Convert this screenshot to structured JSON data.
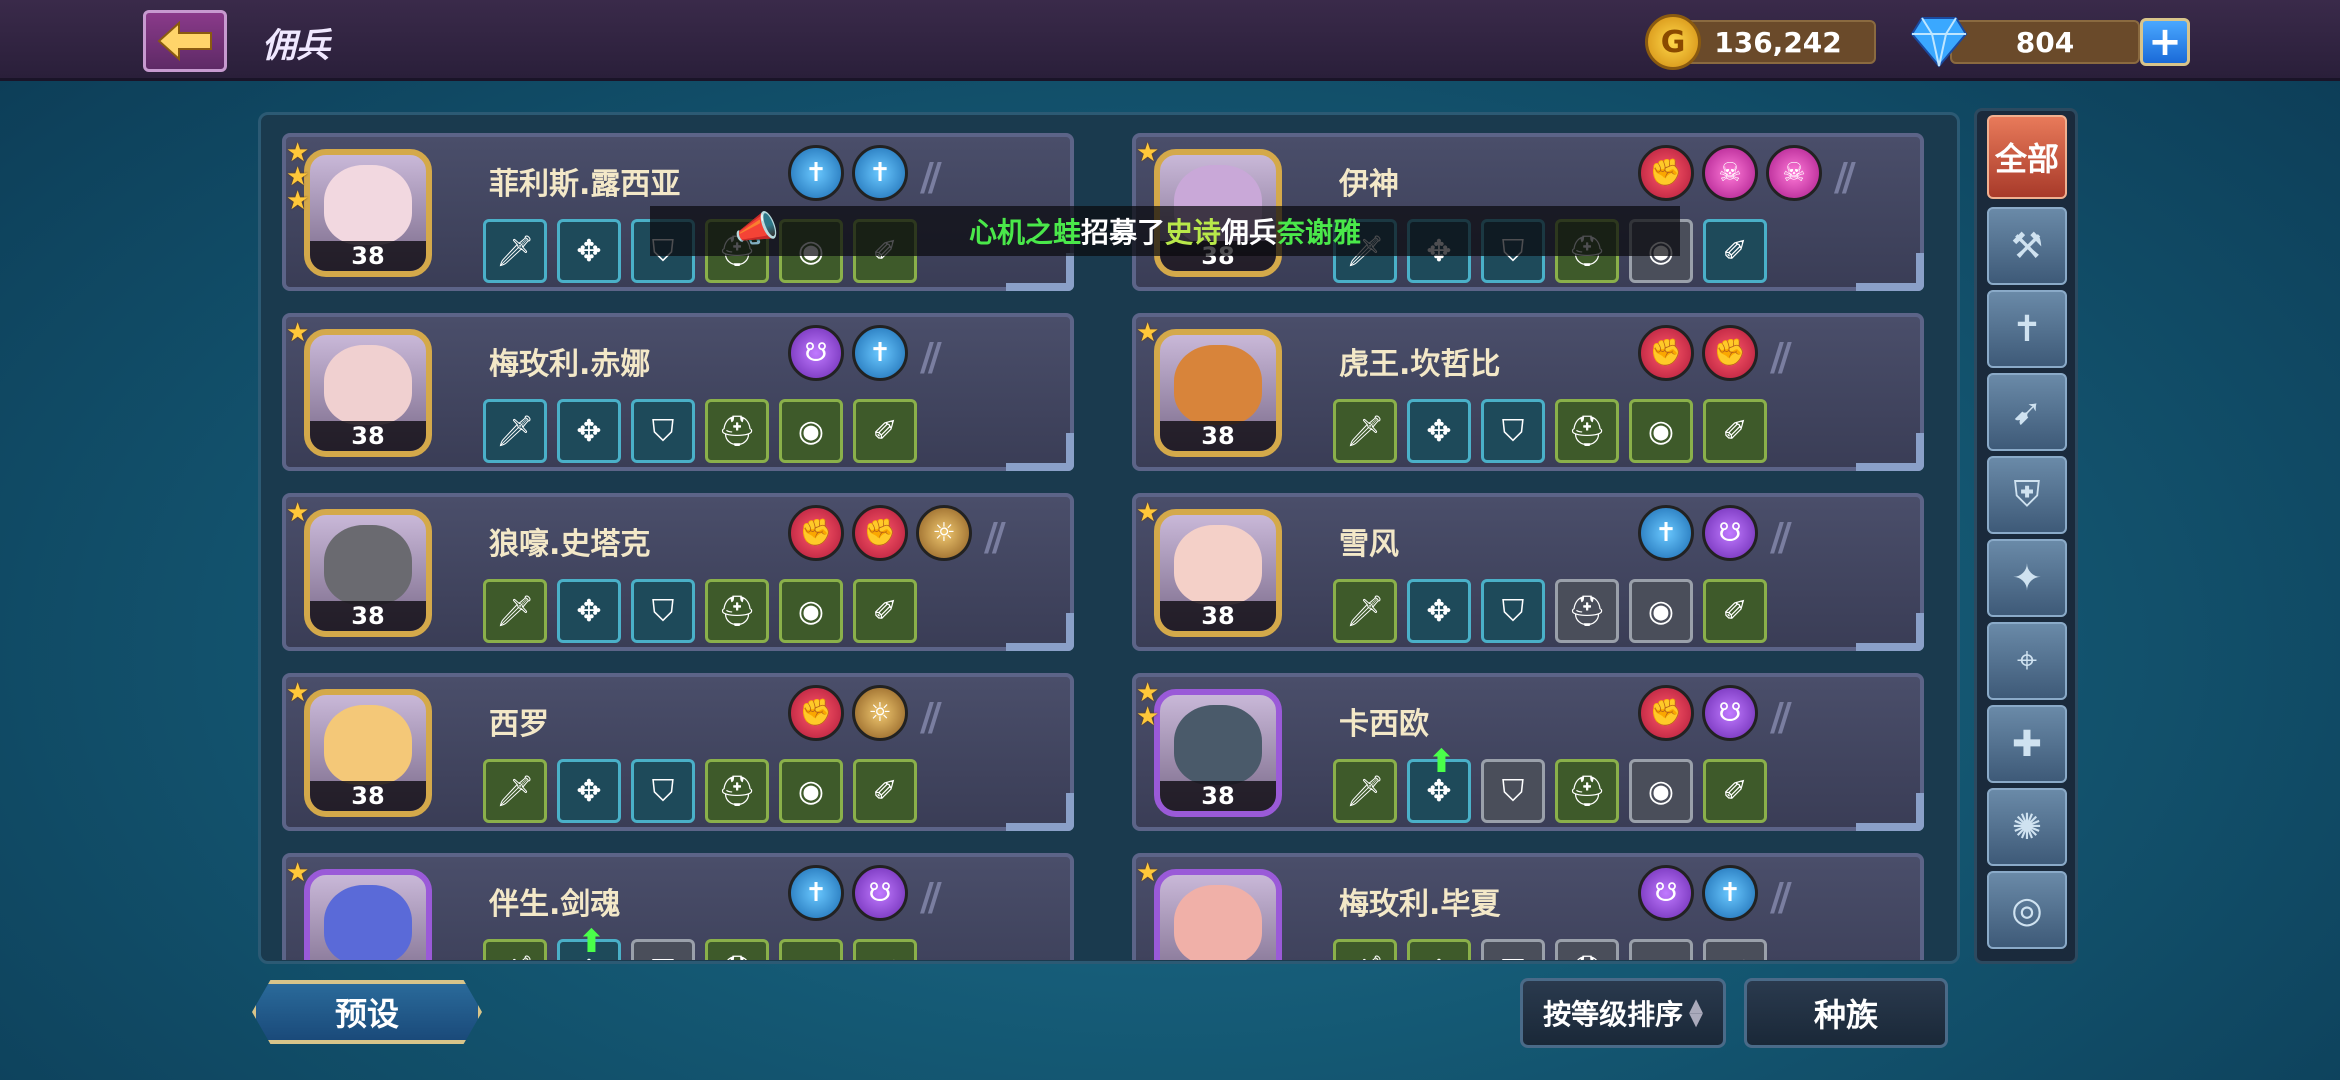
{
  "header": {
    "title": "佣兵",
    "gold": "136,242",
    "gems": "804",
    "coin_glyph": "G",
    "plus_glyph": "+"
  },
  "toast": {
    "p1": "心机之蛙",
    "p2": "招募了",
    "p3": "史诗",
    "p4": "佣兵",
    "p5": "奈谢雅"
  },
  "sidebar": {
    "all_label": "全部",
    "icons": [
      "hammer-icon",
      "sword-icon",
      "bow-icon",
      "shield-icon",
      "shuriken-icon",
      "claw-icon",
      "cross-icon",
      "swirl-icon",
      "circle-icon"
    ],
    "glyphs": [
      "⚒",
      "✝",
      "➹",
      "⛨",
      "✦",
      "⌖",
      "✚",
      "✺",
      "◎"
    ]
  },
  "heroes": [
    {
      "name": "菲利斯.露西亚",
      "level": "38",
      "stars": 3,
      "frame": "gold",
      "face": "#f2d8e0",
      "traits": [
        "blue",
        "blue"
      ]
    },
    {
      "name": "伊神",
      "level": "38",
      "stars": 1,
      "frame": "gold",
      "face": "#c9a8d8",
      "traits": [
        "red",
        "pink",
        "pink"
      ]
    },
    {
      "name": "梅玫利.赤娜",
      "level": "38",
      "stars": 1,
      "frame": "gold",
      "face": "#f0d0d0",
      "traits": [
        "purple",
        "blue"
      ]
    },
    {
      "name": "虎王.坎哲比",
      "level": "38",
      "stars": 1,
      "frame": "gold",
      "face": "#d8843a",
      "traits": [
        "red",
        "red"
      ]
    },
    {
      "name": "狼嚎.史塔克",
      "level": "38",
      "stars": 1,
      "frame": "gold",
      "face": "#6a6a70",
      "traits": [
        "red",
        "red",
        "gold"
      ]
    },
    {
      "name": "雪风",
      "level": "38",
      "stars": 1,
      "frame": "gold",
      "face": "#f4d0c8",
      "traits": [
        "blue",
        "purple"
      ]
    },
    {
      "name": "西罗",
      "level": "38",
      "stars": 1,
      "frame": "gold",
      "face": "#f4c878",
      "traits": [
        "red",
        "gold"
      ]
    },
    {
      "name": "卡西欧",
      "level": "38",
      "stars": 2,
      "frame": "purple",
      "face": "#4a5a6a",
      "traits": [
        "red",
        "purple"
      ]
    },
    {
      "name": "伴生.剑魂",
      "level": "",
      "stars": 1,
      "frame": "purple",
      "face": "#5a6ad8",
      "traits": [
        "blue",
        "purple"
      ]
    },
    {
      "name": "梅玫利.毕夏",
      "level": "",
      "stars": 1,
      "frame": "purple",
      "face": "#f0b0a8",
      "traits": [
        "purple",
        "blue"
      ]
    }
  ],
  "equip_rows": [
    [
      "blue",
      "blue",
      "blue",
      "green",
      "green",
      "green"
    ],
    [
      "blue",
      "blue",
      "blue",
      "green",
      "gray",
      "blue"
    ],
    [
      "blue",
      "blue",
      "blue",
      "green",
      "green",
      "green"
    ],
    [
      "green",
      "blue",
      "blue",
      "green",
      "green",
      "green"
    ],
    [
      "green",
      "blue",
      "blue",
      "green",
      "green",
      "green"
    ],
    [
      "green",
      "blue",
      "blue",
      "gray",
      "gray",
      "green"
    ],
    [
      "green",
      "blue",
      "blue",
      "green",
      "green",
      "green"
    ],
    [
      "green",
      "blue",
      "gray",
      "green",
      "gray",
      "green"
    ],
    [
      "green",
      "blue",
      "gray",
      "green",
      "green",
      "green"
    ],
    [
      "green",
      "green",
      "gray",
      "gray",
      "gray",
      "gray"
    ]
  ],
  "equip_glyphs": [
    "🗡",
    "✥",
    "⛉",
    "⛑",
    "◉",
    "✐"
  ],
  "upgrade_arrows": [
    [
      7,
      1
    ],
    [
      8,
      1
    ]
  ],
  "buttons": {
    "preset": "预设",
    "sort": "按等级排序",
    "race": "种族"
  }
}
